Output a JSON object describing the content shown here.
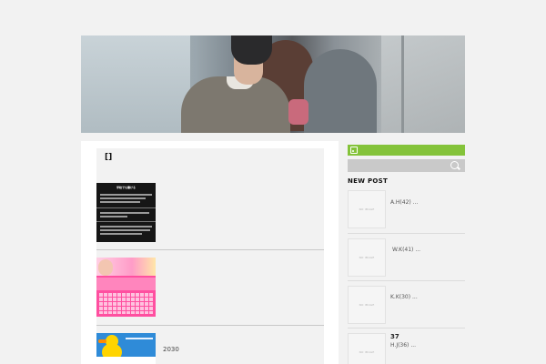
{
  "post": {
    "title": "[]",
    "entries": [
      {
        "thumb_title": "学校でも働ける",
        "date": ""
      },
      {
        "date": ""
      },
      {
        "date": "2030"
      }
    ]
  },
  "sidebar": {
    "new_post_heading": "NEW POST",
    "items": [
      {
        "thumb_label": "NO IMAGE",
        "name": "A.H(42)",
        "more": "..."
      },
      {
        "thumb_label": "NO IMAGE",
        "name": "W.K(41)",
        "more": "..."
      },
      {
        "thumb_label": "NO IMAGE",
        "name": "K.K(30)",
        "more": "..."
      },
      {
        "thumb_label": "NO IMAGE",
        "name": "H.J(36)",
        "more": "...",
        "number": "37"
      }
    ]
  },
  "colors": {
    "page_bg": "#f2f2f2",
    "rss_bar": "#84c33a",
    "search_bar": "#c9c9c9"
  },
  "icons": [
    "rss-icon",
    "search-icon"
  ]
}
